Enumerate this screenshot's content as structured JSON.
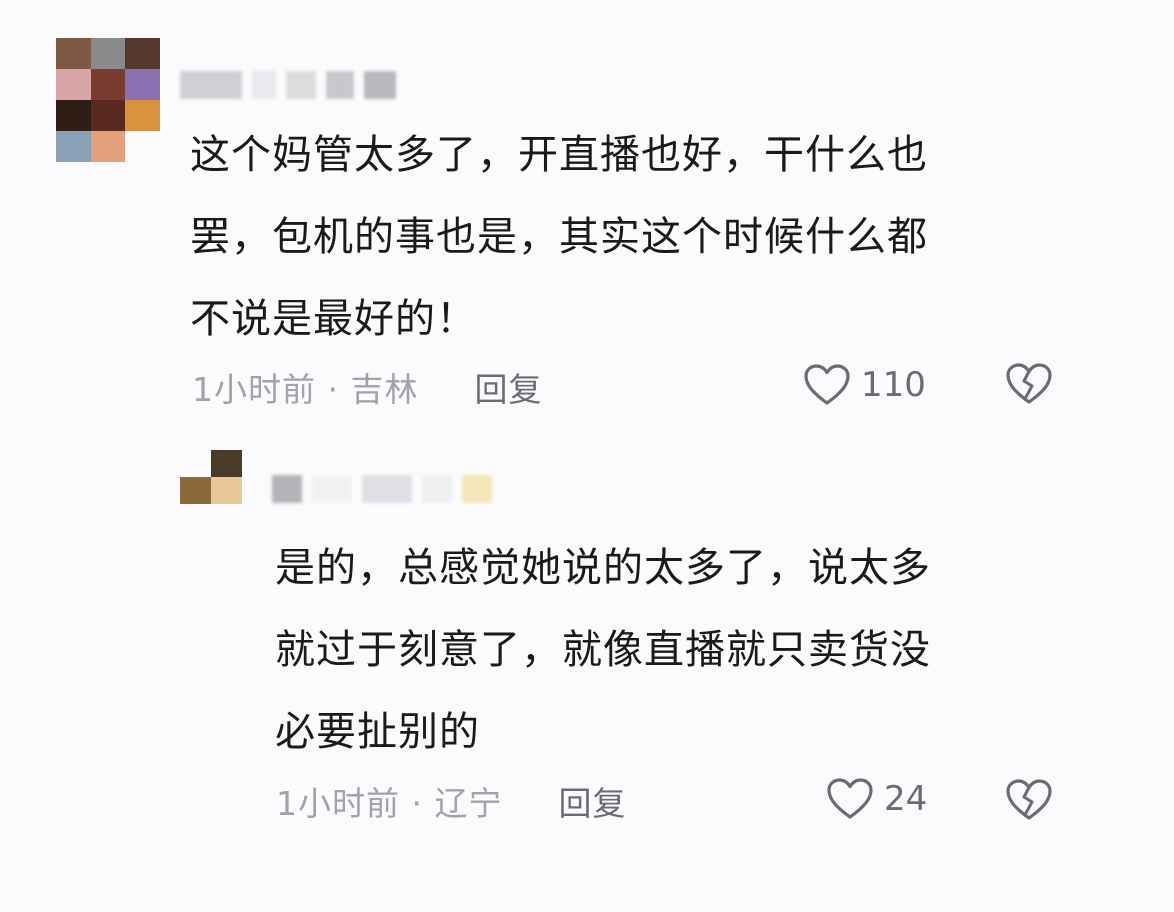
{
  "comment": {
    "text_lines": [
      "这个妈管太多了，开直播也好，干什么也",
      "罢，包机的事也是，其实这个时候什么都",
      "不说是最好的！"
    ],
    "meta": "1小时前 · 吉林",
    "reply_label": "回复",
    "like_count": "110"
  },
  "reply": {
    "text_lines": [
      "是的，总感觉她说的太多了，说太多",
      "就过于刻意了，就像直播就只卖货没",
      "必要扯别的"
    ],
    "meta": "1小时前 · 辽宁",
    "reply_label": "回复",
    "like_count": "24"
  },
  "icons": {
    "like": "heart-outline-icon",
    "dislike": "broken-heart-icon"
  },
  "colors": {
    "background": "#fbfbfd",
    "text": "#1a1a1a",
    "meta": "#a2a2a8",
    "action": "#6b6b72"
  }
}
